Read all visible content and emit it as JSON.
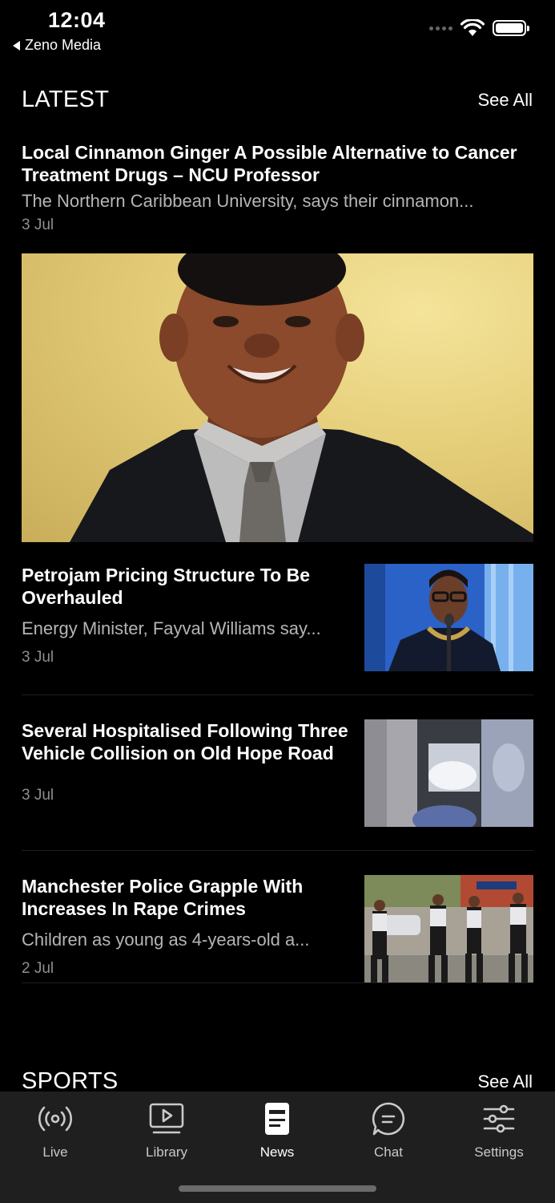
{
  "status_bar": {
    "time": "12:04",
    "back_app": "Zeno Media",
    "icons": [
      "signal-dots-icon",
      "wifi-icon",
      "battery-icon"
    ]
  },
  "latest": {
    "title": "LATEST",
    "see_all": "See All",
    "lead": {
      "title": "Local Cinnamon Ginger A Possible Alternative to Cancer Treatment Drugs – NCU Professor",
      "summary": "The Northern Caribbean University, says their cinnamon...",
      "date": "3 Jul"
    },
    "items": [
      {
        "title": "Petrojam Pricing Structure To Be Overhauled",
        "summary": "Energy Minister, Fayval Williams say...",
        "date": "3 Jul"
      },
      {
        "title": "Several Hospitalised Following Three Vehicle Collision on Old Hope Road",
        "summary": "",
        "date": "3 Jul"
      },
      {
        "title": "Manchester Police Grapple With Increases In Rape Crimes",
        "summary": "Children as young as 4-years-old a...",
        "date": "2 Jul"
      }
    ]
  },
  "sports": {
    "title": "SPORTS",
    "see_all": "See All"
  },
  "tabs": [
    {
      "label": "Live",
      "icon": "broadcast-icon",
      "active": false
    },
    {
      "label": "Library",
      "icon": "play-library-icon",
      "active": false
    },
    {
      "label": "News",
      "icon": "newspaper-icon",
      "active": true
    },
    {
      "label": "Chat",
      "icon": "chat-bubble-icon",
      "active": false
    },
    {
      "label": "Settings",
      "icon": "sliders-icon",
      "active": false
    }
  ],
  "colors": {
    "background": "#000000",
    "tab_bar": "#1f1f1f",
    "secondary_text": "#b5b5b5",
    "date_text": "#8e8e8e"
  }
}
